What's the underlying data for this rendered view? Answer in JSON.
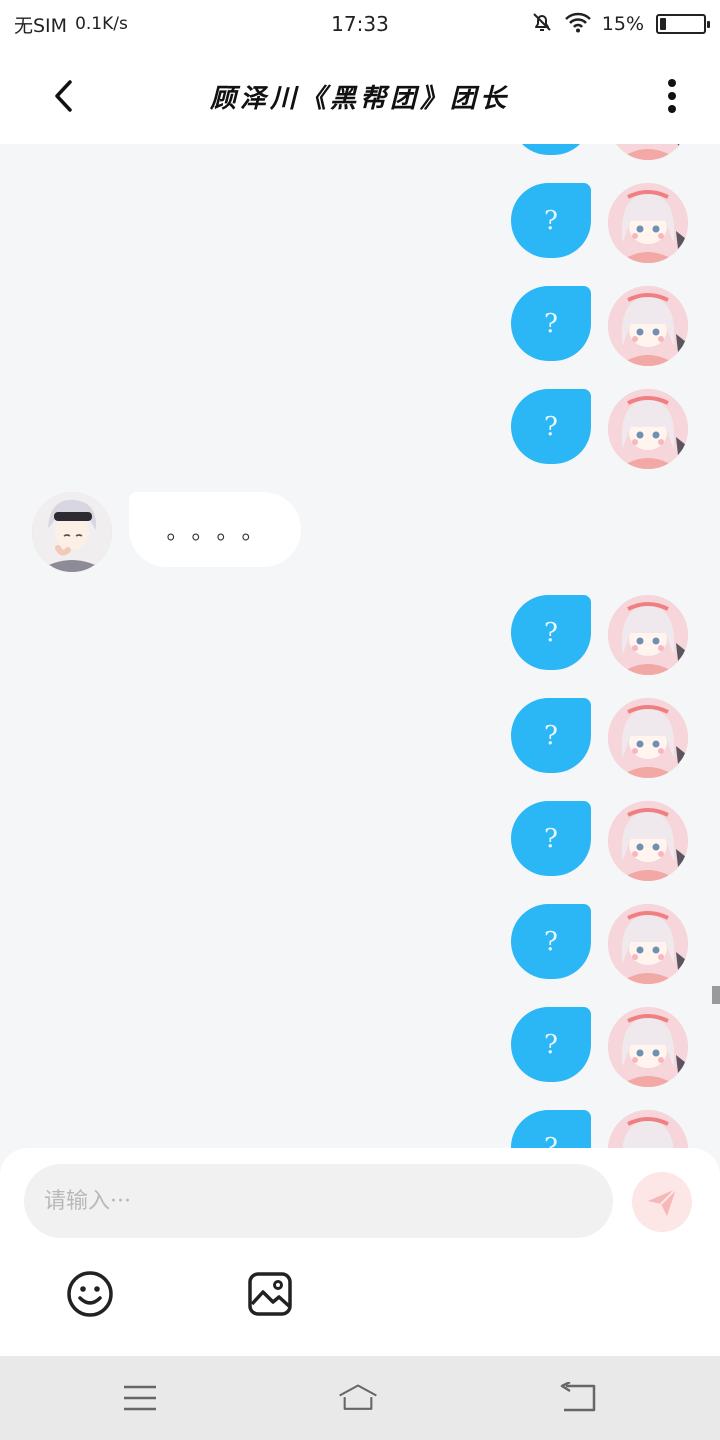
{
  "status_bar": {
    "sim_text": "无SIM",
    "net_speed": "0.1K/s",
    "time": "17:33",
    "battery": "15%",
    "battery_level": 0.15
  },
  "header": {
    "title": "顾泽川《黑帮团》团长",
    "back_icon": "chevron-left-icon",
    "more_icon": "vertical-dots-icon"
  },
  "messages": {
    "self_text": "?",
    "other_text": "。。。。"
  },
  "composer": {
    "placeholder": "请输入···",
    "send_icon": "paper-plane-icon",
    "emoji_icon": "smiley-icon",
    "image_icon": "image-icon"
  },
  "nav_bar": {
    "menu_icon": "menu-icon",
    "home_icon": "home-icon",
    "back_icon": "return-icon"
  },
  "colors": {
    "self_bubble": "#2bb6f6",
    "other_bubble": "#ffffff",
    "background": "#f4f6f8",
    "send_button": "#fde6e6"
  }
}
